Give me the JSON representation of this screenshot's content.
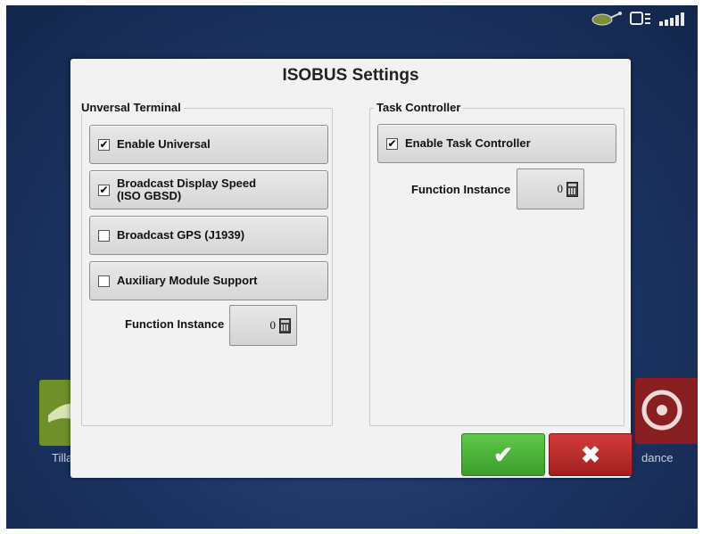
{
  "dialog": {
    "title": "ISOBUS Settings",
    "ok_icon": "checkmark-icon",
    "cancel_icon": "x-icon"
  },
  "universal_terminal": {
    "label": "Unversal Terminal",
    "options": [
      {
        "label": "Enable Universal",
        "checked": true
      },
      {
        "label": "Broadcast Display Speed\n(ISO GBSD)",
        "checked": true
      },
      {
        "label": "Broadcast GPS (J1939)",
        "checked": false
      },
      {
        "label": "Auxiliary Module Support",
        "checked": false
      }
    ],
    "function_instance_label": "Function Instance",
    "function_instance_value": "0"
  },
  "task_controller": {
    "label": "Task Controller",
    "options": [
      {
        "label": "Enable Task Controller",
        "checked": true
      }
    ],
    "function_instance_label": "Function Instance",
    "function_instance_value": "0"
  },
  "background": {
    "left_tile_label": "Tilla",
    "right_tile_label": "dance"
  },
  "status_icons": [
    "field-icon",
    "display-icon",
    "gps-signal-icon"
  ],
  "check_mark": "✔",
  "ok_glyph": "✔",
  "cancel_glyph": "✖"
}
